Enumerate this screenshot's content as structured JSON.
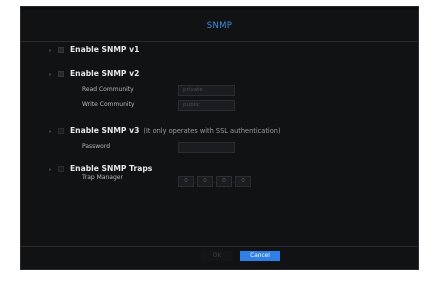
{
  "dialog": {
    "title": "SNMP"
  },
  "snmp_v1": {
    "label": "Enable SNMP v1"
  },
  "snmp_v2": {
    "label": "Enable SNMP v2",
    "read_community_label": "Read Community",
    "read_community_value": "private",
    "write_community_label": "Write Community",
    "write_community_value": "public"
  },
  "snmp_v3": {
    "label": "Enable SNMP v3",
    "note": "(It only operates with SSL authentication)",
    "password_label": "Password",
    "password_value": ""
  },
  "snmp_traps": {
    "label": "Enable SNMP Traps",
    "trap_manager_label": "Trap Manager",
    "octets": [
      "0",
      "0",
      "0",
      "0"
    ]
  },
  "buttons": {
    "ok": "OK",
    "cancel": "Cancel"
  },
  "colors": {
    "accent": "#2f7fe6",
    "title": "#3f8fe0",
    "background": "#111214"
  }
}
